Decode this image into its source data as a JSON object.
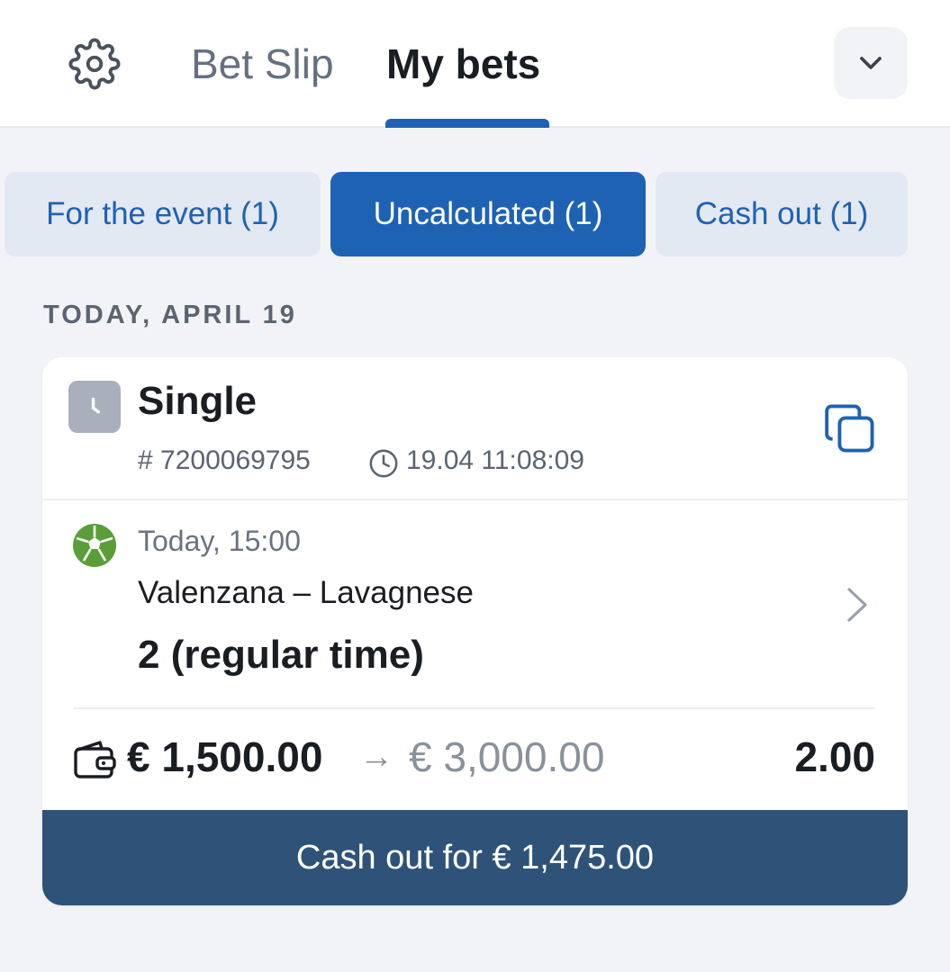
{
  "header": {
    "settings_icon": "gear-icon",
    "tabs": [
      {
        "label": "Bet Slip",
        "active": false
      },
      {
        "label": "My bets",
        "active": true
      }
    ],
    "collapse_icon": "chevron-down-icon"
  },
  "filters": [
    {
      "label": "For the event (1)",
      "active": false
    },
    {
      "label": "Uncalculated (1)",
      "active": true
    },
    {
      "label": "Cash out (1)",
      "active": false
    }
  ],
  "date_group": "TODAY, APRIL 19",
  "bet": {
    "type": "Single",
    "type_icon": "clock-icon",
    "id": "# 7200069795",
    "placed_time": "19.04 11:08:09",
    "copy_icon": "copy-icon",
    "event": {
      "sport_icon": "football-icon",
      "time": "Today, 15:00",
      "name": "Valenzana – Lavagnese",
      "selection": "2 (regular time)"
    },
    "stake": "€ 1,500.00",
    "arrow": "→",
    "potential_payout": "€ 3,000.00",
    "odds": "2.00",
    "cashout_label": "Cash out for € 1,475.00"
  },
  "colors": {
    "accent": "#1e62b4",
    "cashout_bg": "#2f5378",
    "page_bg": "#f1f3f6",
    "football_green": "#5a9e3a"
  }
}
